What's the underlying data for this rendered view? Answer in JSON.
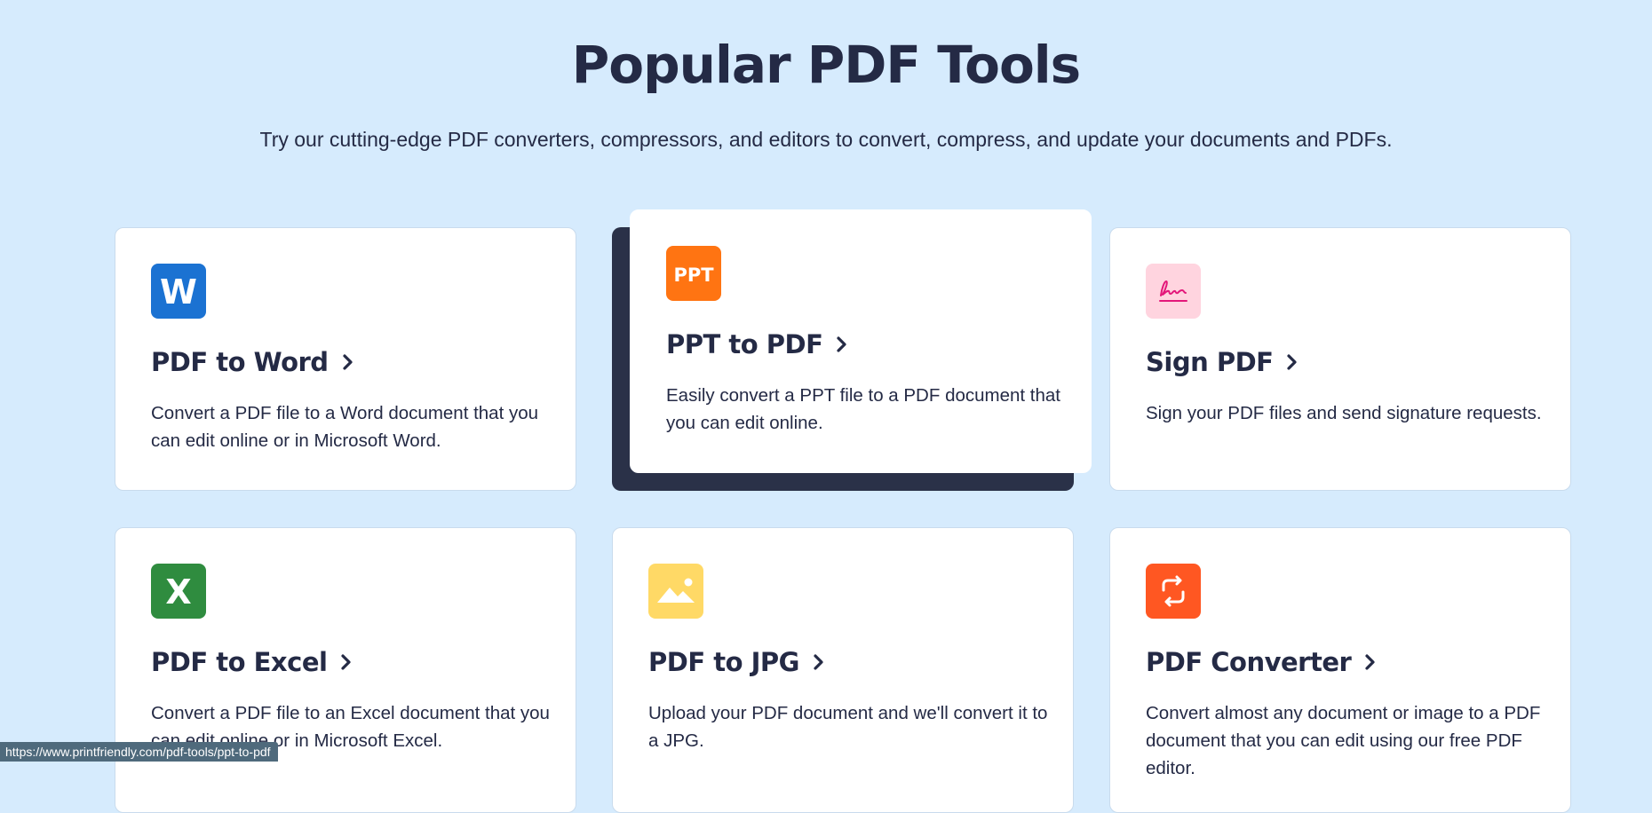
{
  "header": {
    "title": "Popular PDF Tools",
    "subtitle": "Try our cutting-edge PDF converters, compressors, and editors to convert, compress, and update your documents and PDFs."
  },
  "tools": [
    {
      "name": "PDF to Word",
      "description": "Convert a PDF file to a Word document that you can edit online or in Microsoft Word.",
      "icon": "word-icon",
      "icon_text": "W",
      "icon_color": "#1b72d2"
    },
    {
      "name": "PPT to PDF",
      "description": "Easily convert a PPT file to a PDF document that you can edit online.",
      "icon": "ppt-icon",
      "icon_text": "PPT",
      "icon_color": "#ff7412",
      "hovered": true
    },
    {
      "name": "Sign PDF",
      "description": "Sign your PDF files and send signature requests.",
      "icon": "signature-icon",
      "icon_color": "#ffd4df"
    },
    {
      "name": "PDF to Excel",
      "description": "Convert a PDF file to an Excel document that you can edit online or in Microsoft Excel.",
      "icon": "excel-icon",
      "icon_text": "X",
      "icon_color": "#2f8c3f"
    },
    {
      "name": "PDF to JPG",
      "description": "Upload your PDF document and we'll convert it to a JPG.",
      "icon": "image-icon",
      "icon_color": "#ffd966"
    },
    {
      "name": "PDF Converter",
      "description": "Convert almost any document or image to a PDF document that you can edit using our free PDF editor.",
      "icon": "convert-icon",
      "icon_color": "#ff5722"
    }
  ],
  "status_bar": {
    "url": "https://www.printfriendly.com/pdf-tools/ppt-to-pdf"
  }
}
